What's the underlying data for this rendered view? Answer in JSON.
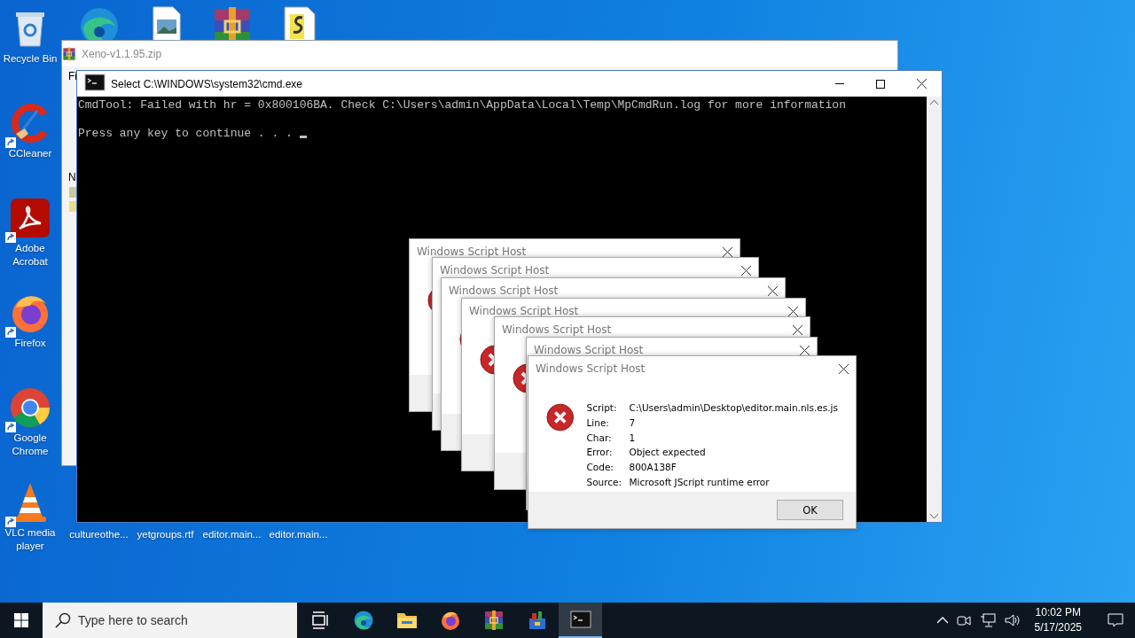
{
  "desktop": {
    "left_icons": [
      {
        "label": "Recycle Bin",
        "kind": "recycle",
        "shortcut": false
      },
      {
        "label": "CCleaner",
        "kind": "ccleaner",
        "shortcut": true
      },
      {
        "label": "Adobe Acrobat",
        "kind": "acrobat",
        "shortcut": true
      },
      {
        "label": "Firefox",
        "kind": "firefox",
        "shortcut": true
      },
      {
        "label": "Google Chrome",
        "kind": "chrome",
        "shortcut": true
      },
      {
        "label": "VLC media player",
        "kind": "vlc",
        "shortcut": true
      }
    ],
    "top_icons": [
      {
        "kind": "edge"
      },
      {
        "kind": "image"
      },
      {
        "kind": "winrar"
      },
      {
        "kind": "script"
      }
    ],
    "bottom_labels": [
      "cultureothe...",
      "yetgroups.rtf",
      "editor.main...",
      "editor.main..."
    ]
  },
  "archive_window": {
    "title": "Xeno-v1.1.95.zip",
    "menu_text": "Fi",
    "column_text": "N"
  },
  "console_window": {
    "title": "Select C:\\WINDOWS\\system32\\cmd.exe",
    "lines": [
      "CmdTool: Failed with hr = 0x800106BA. Check C:\\Users\\admin\\AppData\\Local\\Temp\\MpCmdRun.log for more information",
      "Press any key to continue . . ."
    ]
  },
  "dialogs": [
    {
      "title": "Windows Script Host"
    },
    {
      "title": "Windows Script Host"
    },
    {
      "title": "Windows Script Host"
    },
    {
      "title": "Windows Script Host"
    },
    {
      "title": "Windows Script Host"
    },
    {
      "title": "Windows Script Host"
    },
    {
      "title": "Windows Script Host",
      "details": [
        {
          "label": "Script:",
          "value": "C:\\Users\\admin\\Desktop\\editor.main.nls.es.js"
        },
        {
          "label": "Line:",
          "value": "7"
        },
        {
          "label": "Char:",
          "value": "1"
        },
        {
          "label": "Error:",
          "value": "Object expected"
        },
        {
          "label": "Code:",
          "value": "800A138F"
        },
        {
          "label": "Source:",
          "value": "Microsoft JScript runtime error"
        }
      ],
      "button": "OK"
    }
  ],
  "taskbar": {
    "search": {
      "placeholder": "Type here to search"
    },
    "apps": [
      {
        "kind": "taskview",
        "active": false
      },
      {
        "kind": "edge",
        "active": false
      },
      {
        "kind": "folder",
        "active": false
      },
      {
        "kind": "firefox",
        "active": false
      },
      {
        "kind": "winrar",
        "active": false
      },
      {
        "kind": "tool",
        "active": false
      },
      {
        "kind": "console",
        "active": true
      }
    ],
    "time": "10:02 PM",
    "date": "5/17/2025"
  }
}
